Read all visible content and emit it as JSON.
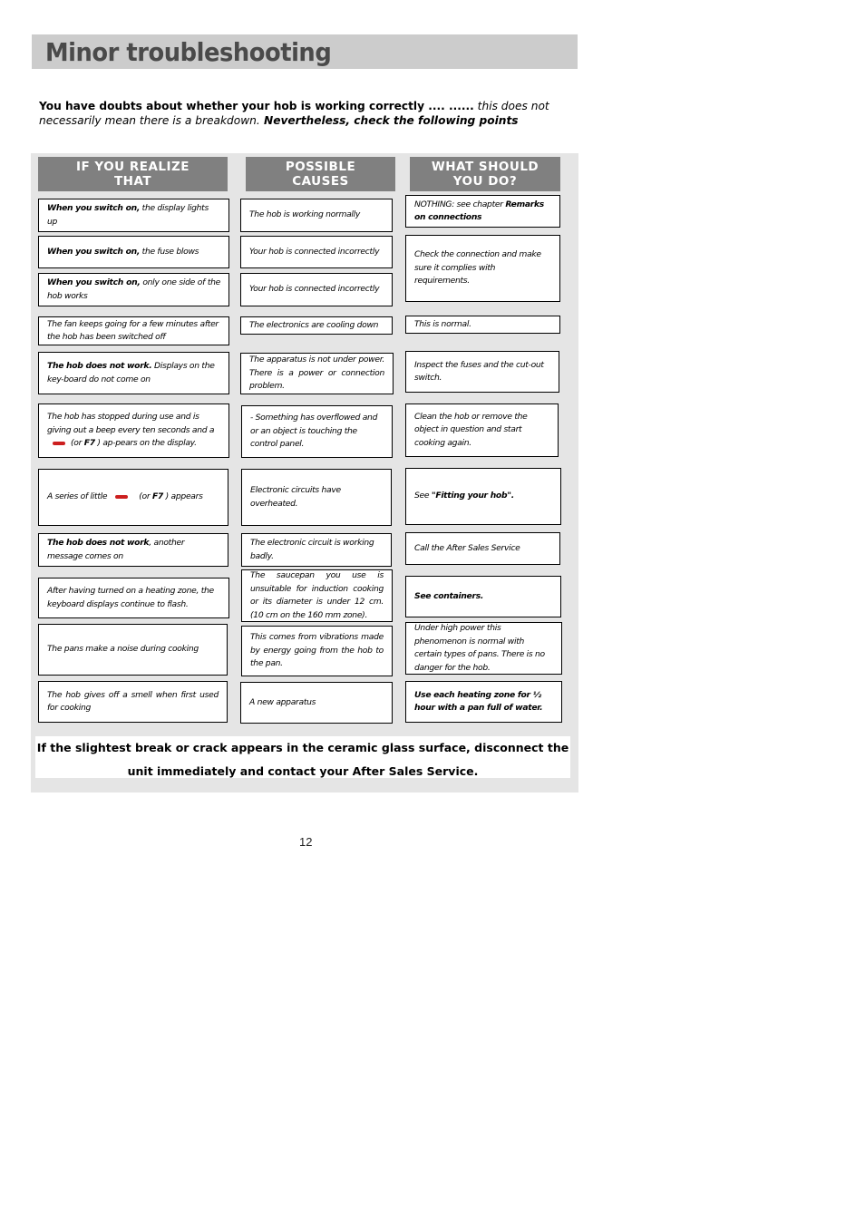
{
  "page": {
    "title": "Minor troubleshooting",
    "intro": {
      "bold": "You have doubts about whether your hob is working correctly .... ......",
      "italic": " this does not necessarily mean there is a breakdown.",
      "bold_italic": " Nevertheless, check the following points"
    },
    "page_number": "12"
  },
  "table": {
    "headers": [
      {
        "line1": "IF YOU REALIZE",
        "line2": "THAT"
      },
      {
        "line1": "POSSIBLE",
        "line2": "CAUSES"
      },
      {
        "line1": "WHAT SHOULD",
        "line2": "YOU DO?"
      }
    ],
    "symptoms": [
      {
        "bold": "When you switch on,",
        "text": " the display lights up"
      },
      {
        "bold": "When you switch on,",
        "text": " the fuse blows"
      },
      {
        "bold": "When you switch on,",
        "text": " only one side of the hob works"
      },
      {
        "bold": "",
        "text": "The fan keeps going for a few minutes after the hob has been switched off"
      },
      {
        "bold": "The hob does not work.",
        "text": "  Displays on the key-board do not come on"
      },
      {
        "pre": "The hob has stopped during use and is giving out a beep every ten seconds and a",
        "mid": "(or",
        "code": "F7",
        "post": ") ap-pears on the display."
      },
      {
        "pre": "A series of little",
        "mid": "(or",
        "code": "F7",
        "post": ") appears"
      },
      {
        "bold": "The hob does not work",
        "text": ", another message comes on"
      },
      {
        "bold": "",
        "text": "After having turned on a heating zone, the keyboard displays continue to flash."
      },
      {
        "bold": "",
        "text": "The pans make a noise during cooking"
      },
      {
        "bold": "",
        "text": "The hob gives off a smell when first used for cooking"
      }
    ],
    "causes": [
      "The hob is working normally",
      "Your hob is connected incorrectly",
      "Your hob is connected incorrectly",
      "The electronics are cooling down",
      "The apparatus is not under power. There is a power or connection problem.",
      "- Something has overflowed and or an object is touching the control panel.",
      "Electronic circuits have overheated.",
      "The electronic circuit is working badly.",
      "The saucepan you use is unsuitable for induction cooking or its diameter is under 12 cm. (10 cm on the 160 mm zone).",
      "This comes from vibrations made by energy going from the hob to the pan.",
      "A new apparatus"
    ],
    "actions": [
      {
        "pre": "NOTHING: see chapter ",
        "bold": "Remarks on connections",
        "post": ""
      },
      {
        "pre": "Check the connection and make sure it complies with requirements.",
        "bold": "",
        "post": ""
      },
      {
        "pre": "This is normal.",
        "bold": "",
        "post": ""
      },
      {
        "pre": "Inspect the fuses and the cut-out switch.",
        "bold": "",
        "post": ""
      },
      {
        "pre": "Clean the hob or remove the object in question and start cooking again.",
        "bold": "",
        "post": ""
      },
      {
        "pre": "See ",
        "bold": "\"Fitting your hob\".",
        "post": ""
      },
      {
        "pre": "Call the After Sales Service",
        "bold": "",
        "post": ""
      },
      {
        "pre": "",
        "bold": "See containers.",
        "post": ""
      },
      {
        "pre": "Under high power this phenomenon is normal with certain types of pans. There is no danger for the hob.",
        "bold": "",
        "post": ""
      },
      {
        "pre": "",
        "bold": "Use each heating zone for ½ hour with a pan full of water.",
        "post": ""
      }
    ],
    "error_symbol": {
      "name": "red-dash-symbol",
      "color": "#cc1f1f"
    }
  },
  "warning": {
    "line1": "If the slightest break or crack appears in the ceramic glass surface, disconnect the",
    "line2": "unit immediately and contact your After Sales Service."
  }
}
